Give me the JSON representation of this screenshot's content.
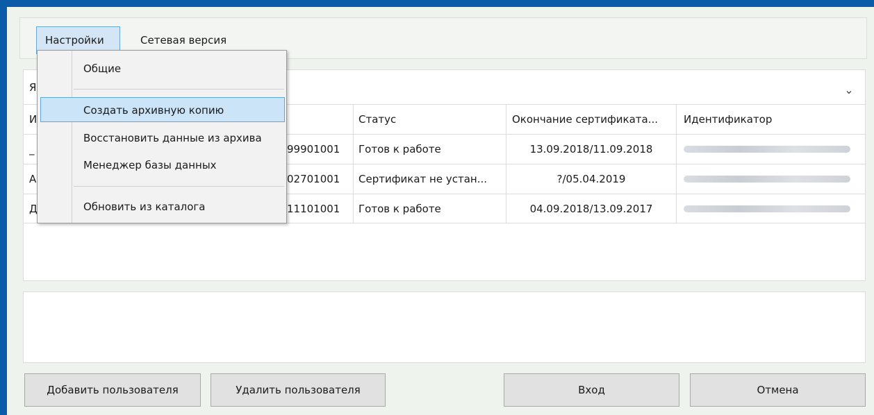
{
  "menubar": {
    "items": [
      {
        "label": "Настройки"
      },
      {
        "label": "Сетевая версия"
      }
    ]
  },
  "settings_menu": {
    "items": [
      {
        "label": "Общие"
      },
      {
        "label": "Создать архивную копию"
      },
      {
        "label": "Восстановить данные из архива"
      },
      {
        "label": "Менеджер базы данных"
      },
      {
        "label": "Обновить из каталога"
      }
    ],
    "highlighted": "Создать архивную копию"
  },
  "combo": {
    "left_fragment": "Я",
    "arrow_icon": "chevron-down-icon"
  },
  "table": {
    "first_header_fragment": "И",
    "headers": [
      "Статус",
      "Окончание сертификата...",
      "Идентификатор"
    ],
    "rows": [
      {
        "first_fragment": "_",
        "code": "99901001",
        "status": "Готов к работе",
        "cert_end": "13.09.2018/11.09.2018",
        "identifier": ""
      },
      {
        "first_fragment": "А",
        "code": "02701001",
        "status": "Сертификат не устан...",
        "cert_end": "?/05.04.2019",
        "identifier": ""
      },
      {
        "first_fragment": "Д",
        "code": "11101001",
        "status": "Готов к работе",
        "cert_end": "04.09.2018/13.09.2017",
        "identifier": ""
      }
    ]
  },
  "buttons": {
    "add_user": "Добавить пользователя",
    "delete_user": "Удалить пользователя",
    "login": "Вход",
    "cancel": "Отмена"
  },
  "colors": {
    "window_frame": "#0b5ca8",
    "highlight": "#cce4f7",
    "highlight_border": "#5fa6d9"
  }
}
